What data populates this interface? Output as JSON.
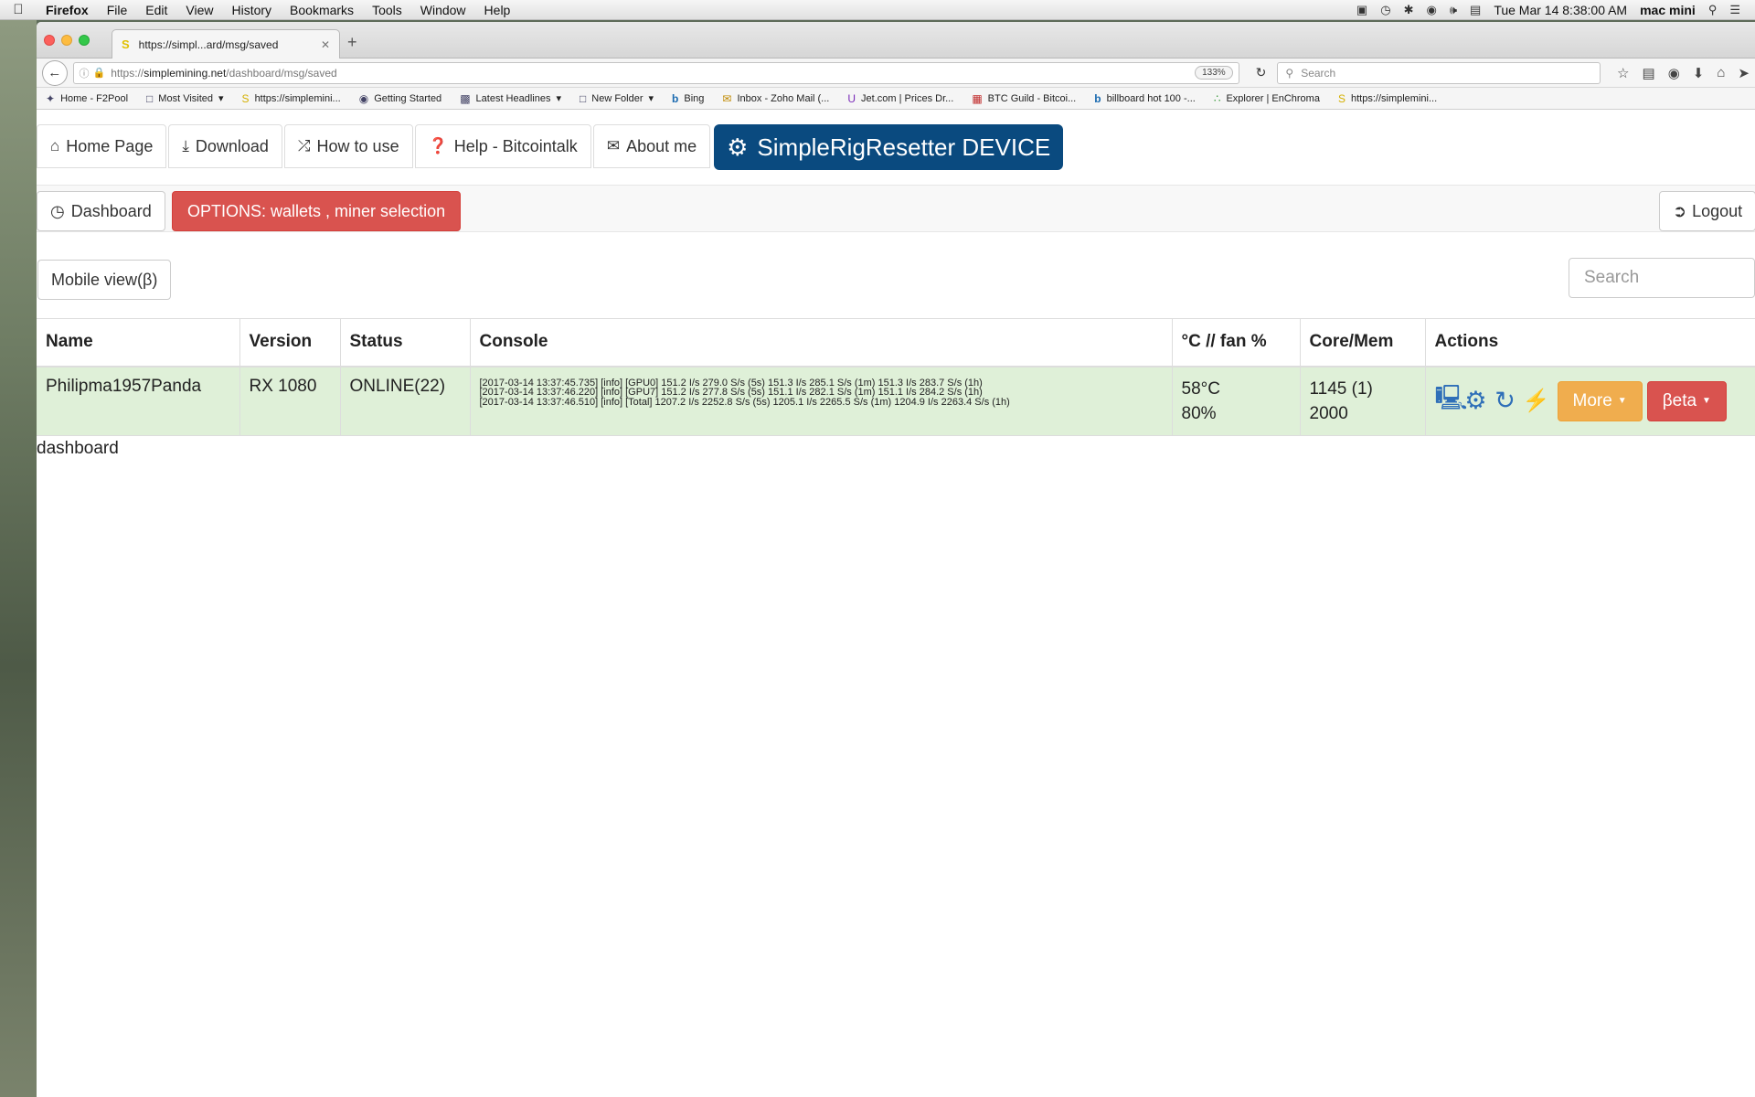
{
  "menubar": {
    "app": "Firefox",
    "items": [
      "File",
      "Edit",
      "View",
      "History",
      "Bookmarks",
      "Tools",
      "Window",
      "Help"
    ],
    "datetime": "Tue Mar 14  8:38:00 AM",
    "user": "mac mini"
  },
  "browser": {
    "tab_title": "https://simpl...ard/msg/saved",
    "url_prefix": "https://",
    "url_domain": "simplemining.net",
    "url_path": "/dashboard/msg/saved",
    "zoom": "133%",
    "search_placeholder": "Search",
    "bookmarks": [
      "Home - F2Pool",
      "Most Visited",
      "https://simplemini...",
      "Getting Started",
      "Latest Headlines",
      "New Folder",
      "Bing",
      "Inbox - Zoho Mail (...",
      "Jet.com | Prices Dr...",
      "BTC Guild - Bitcoi...",
      "billboard hot 100 -...",
      "Explorer | EnChroma",
      "https://simplemini..."
    ]
  },
  "nav": {
    "home": "Home Page",
    "download": "Download",
    "how_to_use": "How to use",
    "help": "Help - Bitcointalk",
    "about": "About me",
    "brand": "SimpleRigResetter DEVICE"
  },
  "subnav": {
    "dashboard": "Dashboard",
    "options": "OPTIONS: wallets , miner selection",
    "logout": "Logout"
  },
  "mobile_view": "Mobile view(β)",
  "search_placeholder": "Search",
  "table": {
    "headers": [
      "Name",
      "Version",
      "Status",
      "Console",
      "°C // fan %",
      "Core/Mem",
      "Actions"
    ],
    "rows": [
      {
        "name": "Philipma1957Panda",
        "version": "RX 1080",
        "status": "ONLINE(22)",
        "console": [
          "[2017-03-14 13:37:45.735] [info] [GPU0] 151.2 I/s 279.0 S/s (5s) 151.3 I/s 285.1 S/s (1m) 151.3 I/s 283.7 S/s (1h)",
          "[2017-03-14 13:37:46.220] [info] [GPU7] 151.2 I/s 277.8 S/s (5s) 151.1 I/s 282.1 S/s (1m) 151.1 I/s 284.2 S/s (1h)",
          "[2017-03-14 13:37:46.510] [info] [Total] 1207.2 I/s 2252.8 S/s (5s) 1205.1 I/s 2265.5 S/s (1m) 1204.9 I/s 2263.4 S/s (1h)"
        ],
        "temp": "58°C",
        "fan": "80%",
        "core": "1145 (1)",
        "mem": "2000",
        "more_label": "More",
        "beta_label": "βeta"
      }
    ]
  },
  "footer_text": "dashboard",
  "colors": {
    "brand_blue": "#0a4a7f",
    "danger_red": "#d9534f",
    "warning_orange": "#f0ad4e",
    "row_green": "#dff0d8",
    "action_icon_blue": "#2f6fb8"
  },
  "icons": {
    "home": "home-icon",
    "download": "download-icon",
    "shuffle": "shuffle-icon",
    "help": "question-circle-icon",
    "mail": "envelope-icon",
    "brand": "gear-icon",
    "dashboard": "dashboard-gauge-icon",
    "logout": "sign-in-icon",
    "actions": [
      "monitor-icon",
      "gear-icon",
      "refresh-icon",
      "lightning-icon"
    ]
  }
}
